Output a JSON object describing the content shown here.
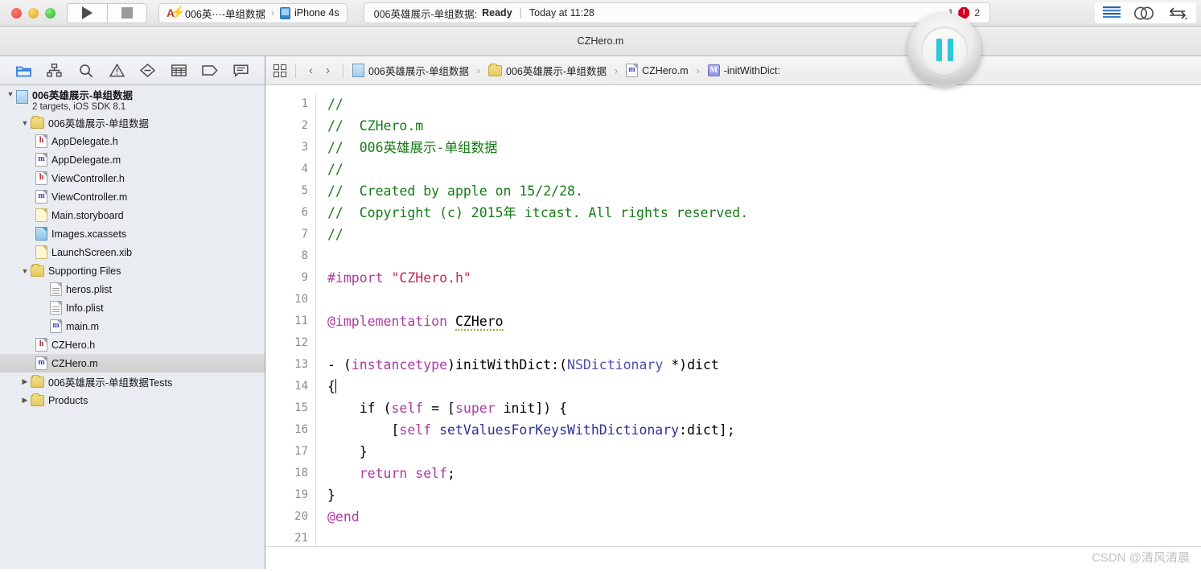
{
  "window": {
    "title": "CZHero.m"
  },
  "toolbar": {
    "run_label": "Run",
    "stop_label": "Stop",
    "scheme": "006英···-单组数据",
    "destination": "iPhone 4s",
    "status_project": "006英雄展示-单组数据:",
    "status_state": "Ready",
    "status_separator": "|",
    "status_time": "Today at 11:28",
    "warning_count": "1",
    "error_count": "2",
    "editor_standard_label": "Standard Editor",
    "editor_assistant_label": "Assistant Editor",
    "editor_version_label": "Version Editor"
  },
  "pause_button": {
    "label": "Pause"
  },
  "navigator": {
    "icons": [
      {
        "name": "folder-icon",
        "label": "Project navigator",
        "active": true
      },
      {
        "name": "hierarchy-icon",
        "label": "Symbol navigator",
        "active": false
      },
      {
        "name": "search-icon",
        "label": "Find navigator",
        "active": false
      },
      {
        "name": "warning-icon",
        "label": "Issue navigator",
        "active": false
      },
      {
        "name": "breakpoint-icon",
        "label": "Test navigator",
        "active": false
      },
      {
        "name": "report-icon",
        "label": "Report navigator",
        "active": false
      },
      {
        "name": "tag-icon",
        "label": "Debug navigator",
        "active": false
      },
      {
        "name": "comment-icon",
        "label": "Log navigator",
        "active": false
      }
    ],
    "tree": [
      {
        "id": "project",
        "label": "006英雄展示-单组数据",
        "sub": "2 targets, iOS SDK 8.1",
        "icon": "project-file-icon",
        "indent": 0,
        "twisty": "down",
        "selected": false
      },
      {
        "id": "group-main",
        "label": "006英雄展示-单组数据",
        "icon": "folder-icon",
        "indent": 1,
        "twisty": "down",
        "selected": false
      },
      {
        "id": "appdelegate-h",
        "label": "AppDelegate.h",
        "icon": "header-file-icon",
        "indent": 2,
        "twisty": "",
        "selected": false
      },
      {
        "id": "appdelegate-m",
        "label": "AppDelegate.m",
        "icon": "impl-file-icon",
        "indent": 2,
        "twisty": "",
        "selected": false
      },
      {
        "id": "viewcontroller-h",
        "label": "ViewController.h",
        "icon": "header-file-icon",
        "indent": 2,
        "twisty": "",
        "selected": false
      },
      {
        "id": "viewcontroller-m",
        "label": "ViewController.m",
        "icon": "impl-file-icon",
        "indent": 2,
        "twisty": "",
        "selected": false
      },
      {
        "id": "main-storyboard",
        "label": "Main.storyboard",
        "icon": "storyboard-file-icon",
        "indent": 2,
        "twisty": "",
        "selected": false
      },
      {
        "id": "images-xcassets",
        "label": "Images.xcassets",
        "icon": "assets-file-icon",
        "indent": 2,
        "twisty": "",
        "selected": false
      },
      {
        "id": "launchscreen-xib",
        "label": "LaunchScreen.xib",
        "icon": "xib-file-icon",
        "indent": 2,
        "twisty": "",
        "selected": false
      },
      {
        "id": "supporting-files",
        "label": "Supporting Files",
        "icon": "folder-icon",
        "indent": 2,
        "twisty": "down",
        "selected": false
      },
      {
        "id": "heros-plist",
        "label": "heros.plist",
        "icon": "plist-file-icon",
        "indent": 3,
        "twisty": "",
        "selected": false
      },
      {
        "id": "info-plist",
        "label": "Info.plist",
        "icon": "plist-file-icon",
        "indent": 3,
        "twisty": "",
        "selected": false
      },
      {
        "id": "main-m",
        "label": "main.m",
        "icon": "impl-file-icon",
        "indent": 3,
        "twisty": "",
        "selected": false
      },
      {
        "id": "czhero-h",
        "label": "CZHero.h",
        "icon": "header-file-icon",
        "indent": 2,
        "twisty": "",
        "selected": false
      },
      {
        "id": "czhero-m",
        "label": "CZHero.m",
        "icon": "impl-file-icon",
        "indent": 2,
        "twisty": "",
        "selected": true
      },
      {
        "id": "tests-group",
        "label": "006英雄展示-单组数据Tests",
        "icon": "folder-icon",
        "indent": 1,
        "twisty": "right",
        "selected": false
      },
      {
        "id": "products-group",
        "label": "Products",
        "icon": "folder-icon",
        "indent": 1,
        "twisty": "right",
        "selected": false
      }
    ]
  },
  "jump_bar": {
    "assistant_icon_label": "related-items",
    "back_label": "Back",
    "forward_label": "Forward",
    "breadcrumbs": [
      {
        "label": "006英雄展示-单组数据",
        "icon": "project-file-icon"
      },
      {
        "label": "006英雄展示-单组数据",
        "icon": "folder-icon"
      },
      {
        "label": "CZHero.m",
        "icon": "impl-file-icon"
      },
      {
        "label": "-initWithDict:",
        "icon": "method-badge-icon"
      }
    ]
  },
  "editor": {
    "line_numbers": [
      "1",
      "2",
      "3",
      "4",
      "5",
      "6",
      "7",
      "8",
      "9",
      "10",
      "11",
      "12",
      "13",
      "14",
      "15",
      "16",
      "17",
      "18",
      "19",
      "20",
      "21"
    ],
    "warning_line": "11",
    "lines": [
      "//",
      "//  CZHero.m",
      "//  006英雄展示-单组数据",
      "//",
      "//  Created by apple on 15/2/28.",
      "//  Copyright (c) 2015年 itcast. All rights reserved.",
      "//",
      "",
      "#import \"CZHero.h\"",
      "",
      "@implementation CZHero",
      "",
      "- (instancetype)initWithDict:(NSDictionary *)dict",
      "{",
      "    if (self = [super init]) {",
      "        [self setValuesForKeysWithDictionary:dict];",
      "    }",
      "    return self;",
      "}",
      "@end",
      ""
    ],
    "tokens": {
      "comment_color": "#177a17",
      "preprocessor_color": "#ad3ba4",
      "string_color": "#c7254e",
      "keyword_color": "#ad3ba4",
      "type_color": "#4b4fb0",
      "method_color": "#2b2f9e",
      "plain_color": "#000000"
    }
  },
  "watermark": {
    "text": "CSDN @清风清晨"
  }
}
